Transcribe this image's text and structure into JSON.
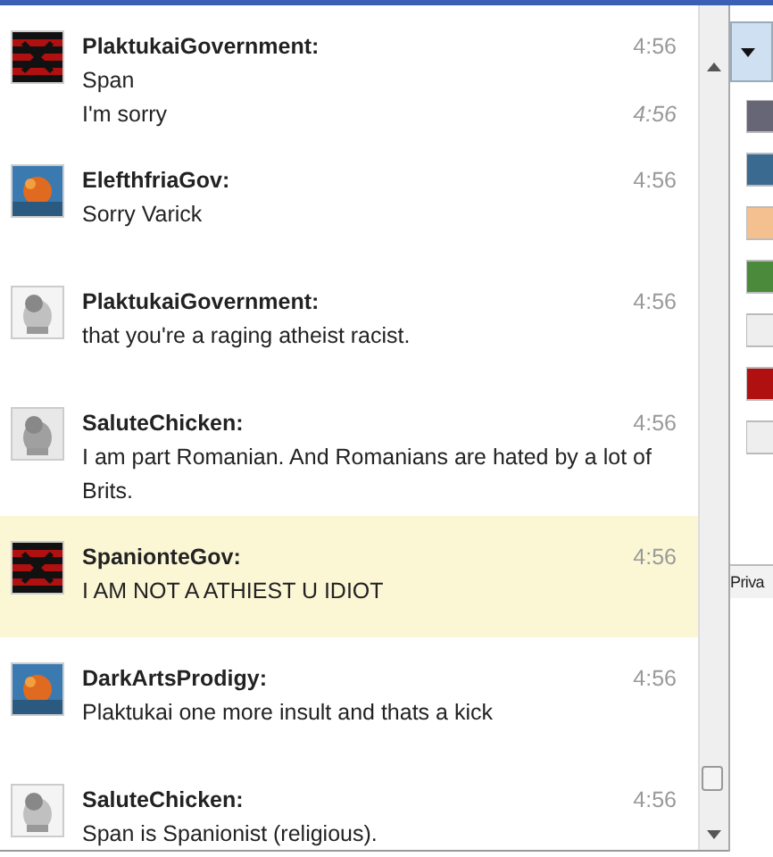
{
  "chat": {
    "messages": [
      {
        "name": "PlaktukaiGovernment:",
        "time": "4:56",
        "highlighted": false,
        "lines": [
          {
            "text": "Span"
          },
          {
            "text": "I'm sorry",
            "time": "4:56"
          }
        ]
      },
      {
        "name": "ElefthfriaGov:",
        "time": "4:56",
        "highlighted": false,
        "lines": [
          {
            "text": "Sorry Varick"
          }
        ]
      },
      {
        "name": "PlaktukaiGovernment:",
        "time": "4:56",
        "highlighted": false,
        "lines": [
          {
            "text": "that you're a raging atheist racist."
          }
        ]
      },
      {
        "name": "SaluteChicken:",
        "time": "4:56",
        "highlighted": false,
        "lines": [
          {
            "text": "I am part Romanian. And Romanians are hated by a lot of Brits."
          }
        ]
      },
      {
        "name": "SpanionteGov:",
        "time": "4:56",
        "highlighted": true,
        "lines": [
          {
            "text": "I AM NOT A ATHIEST U IDIOT"
          }
        ]
      },
      {
        "name": "DarkArtsProdigy:",
        "time": "4:56",
        "highlighted": false,
        "lines": [
          {
            "text": "Plaktukai one more insult and thats a kick"
          }
        ]
      },
      {
        "name": "SaluteChicken:",
        "time": "4:56",
        "highlighted": false,
        "lines": [
          {
            "text": "Span is Spanionist (religious)."
          }
        ]
      }
    ]
  },
  "side_panel": {
    "tab_label": "Priva"
  }
}
